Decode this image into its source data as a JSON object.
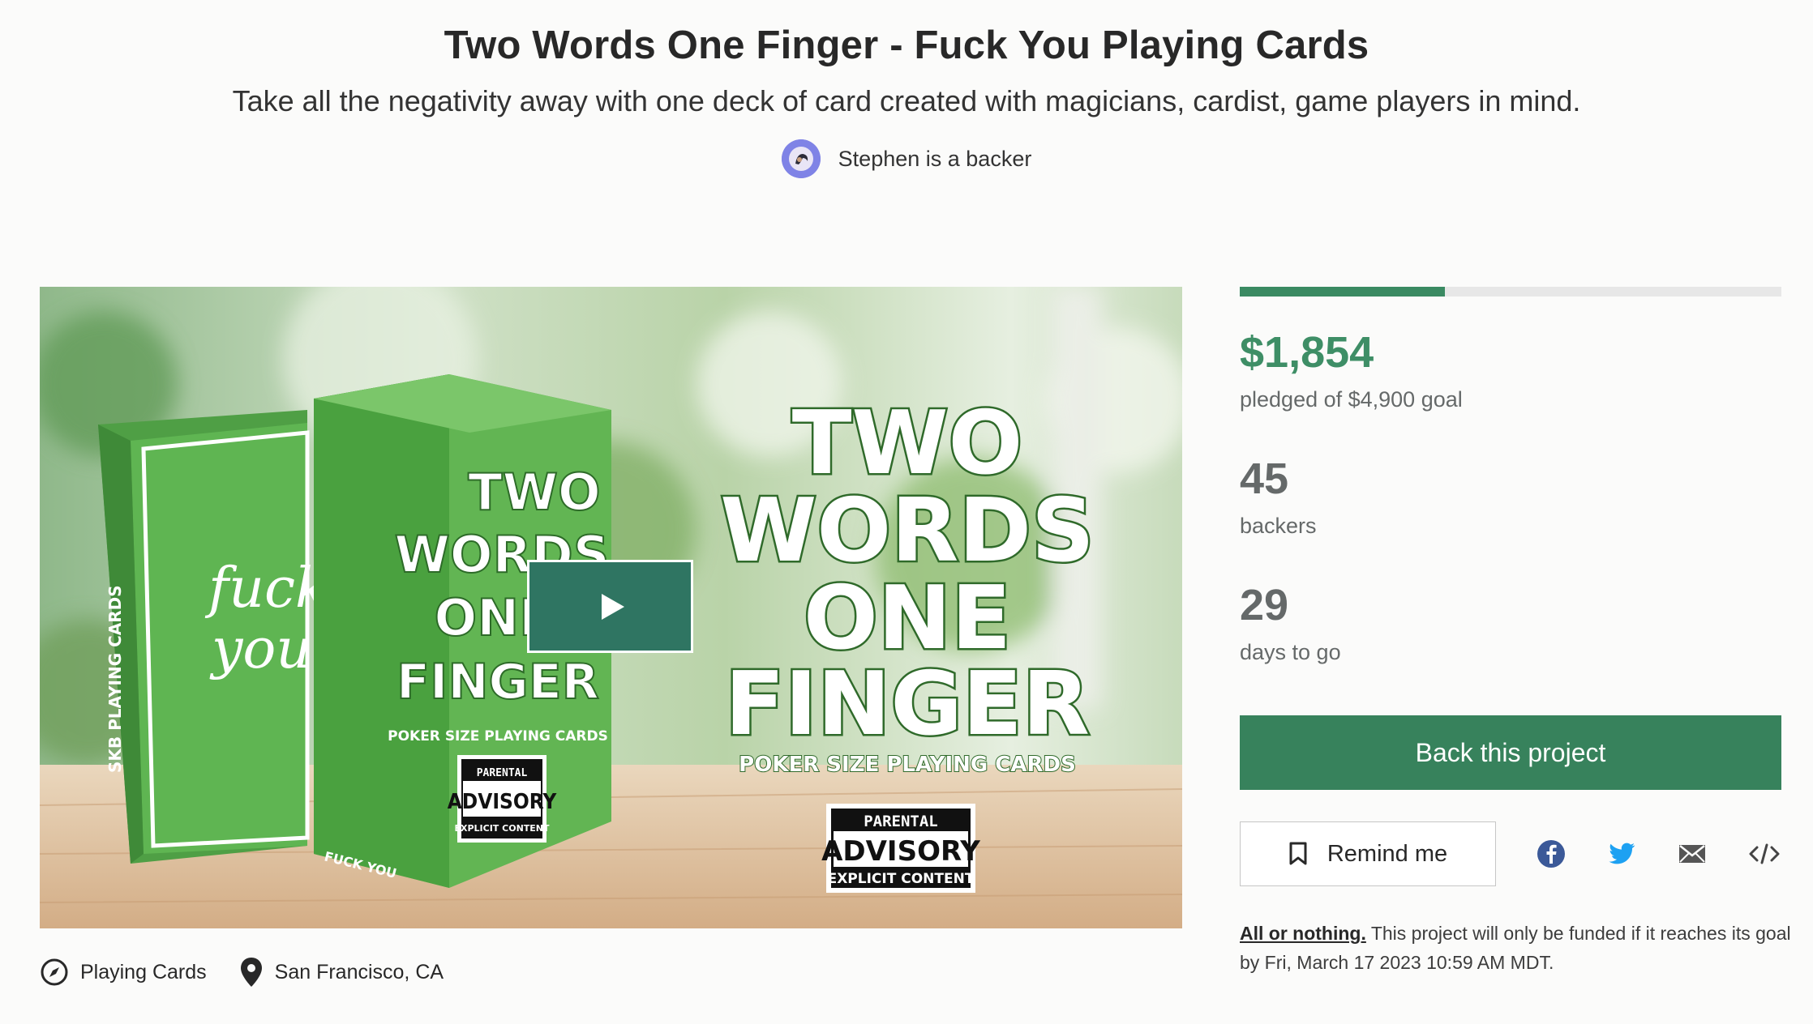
{
  "project": {
    "title": "Two Words One Finger - Fuck You Playing Cards",
    "subtitle": "Take all the negativity away with one deck of card created with magicians, cardist, game players in mind.",
    "backer_note": "Stephen is a backer"
  },
  "media": {
    "box_side_text": "SKB PLAYING CARDS",
    "card_script": [
      "fuck",
      "you"
    ],
    "box_title_lines": [
      "TWO",
      "WORDS",
      "ONE",
      "FINGER"
    ],
    "box_caption": "POKER SIZE PLAYING CARDS",
    "box_bottom_text": "FUCK YOU",
    "headline_lines": [
      "TWO",
      "WORDS",
      "ONE",
      "FINGER"
    ],
    "headline_caption": "POKER SIZE PLAYING CARDS",
    "advisory": [
      "PARENTAL",
      "ADVISORY",
      "EXPLICIT CONTENT"
    ],
    "play_icon": "play-icon"
  },
  "meta": {
    "category": "Playing Cards",
    "category_icon": "compass-icon",
    "location": "San Francisco, CA",
    "location_icon": "map-pin-icon"
  },
  "stats": {
    "progress_fraction": 0.378,
    "pledged": "$1,854",
    "pledged_label": "pledged of $4,900 goal",
    "backers": "45",
    "backers_label": "backers",
    "days": "29",
    "days_label": "days to go"
  },
  "actions": {
    "back_label": "Back this project",
    "remind_label": "Remind me",
    "remind_icon": "bookmark-icon",
    "share_icons": [
      "facebook-icon",
      "twitter-icon",
      "email-icon",
      "embed-icon"
    ]
  },
  "fineprint": {
    "link": "All or nothing.",
    "text": " This project will only be funded if it reaches its goal by Fri, March 17 2023 10:59 AM MDT."
  },
  "colors": {
    "accent_green": "#3e8e66",
    "button_green": "#37825c",
    "play_green": "#2f7562",
    "card_green": "#5ab04f"
  }
}
